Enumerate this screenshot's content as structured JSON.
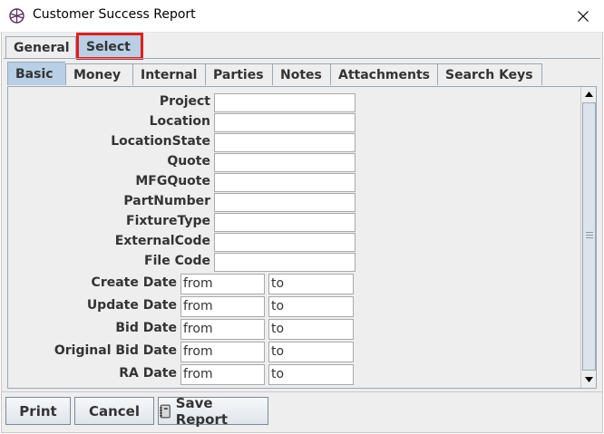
{
  "window": {
    "title": "Customer Success Report"
  },
  "outer_tabs": [
    {
      "label": "General"
    },
    {
      "label": "Select"
    }
  ],
  "inner_tabs": [
    {
      "label": "Basic"
    },
    {
      "label": "Money"
    },
    {
      "label": "Internal"
    },
    {
      "label": "Parties"
    },
    {
      "label": "Notes"
    },
    {
      "label": "Attachments"
    },
    {
      "label": "Search Keys"
    }
  ],
  "text_fields": [
    {
      "label": "Project",
      "value": ""
    },
    {
      "label": "Location",
      "value": ""
    },
    {
      "label": "LocationState",
      "value": ""
    },
    {
      "label": "Quote",
      "value": ""
    },
    {
      "label": "MFGQuote",
      "value": ""
    },
    {
      "label": "PartNumber",
      "value": ""
    },
    {
      "label": "FixtureType",
      "value": ""
    },
    {
      "label": "ExternalCode",
      "value": ""
    },
    {
      "label": "File Code",
      "value": ""
    }
  ],
  "date_ranges": [
    {
      "label": "Create Date",
      "from": "from",
      "to": "to"
    },
    {
      "label": "Update Date",
      "from": "from",
      "to": "to"
    },
    {
      "label": "Bid Date",
      "from": "from",
      "to": "to"
    },
    {
      "label": "Original Bid Date",
      "from": "from",
      "to": "to"
    },
    {
      "label": "RA Date",
      "from": "from",
      "to": "to"
    }
  ],
  "buttons": {
    "print": "Print",
    "cancel": "Cancel",
    "save_report": "Save Report"
  },
  "icons": {
    "app": "app-logo-icon",
    "close": "close-icon",
    "save": "notebook-icon"
  }
}
